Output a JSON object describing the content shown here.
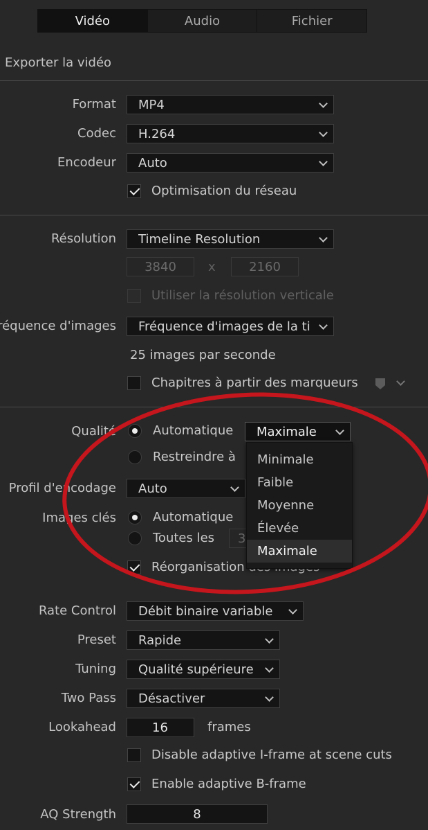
{
  "tabs": [
    {
      "label": "Vidéo",
      "active": true
    },
    {
      "label": "Audio",
      "active": false
    },
    {
      "label": "Fichier",
      "active": false
    }
  ],
  "export_video_label": "Exporter la vidéo",
  "format": {
    "label": "Format",
    "value": "MP4"
  },
  "codec": {
    "label": "Codec",
    "value": "H.264"
  },
  "encoder": {
    "label": "Encodeur",
    "value": "Auto"
  },
  "network_opt": {
    "label": "Optimisation du réseau",
    "checked": true
  },
  "resolution": {
    "label": "Résolution",
    "value": "Timeline Resolution",
    "width": "3840",
    "x": "x",
    "height": "2160"
  },
  "vertical_res": {
    "label": "Utiliser la résolution verticale",
    "checked": false,
    "disabled": true
  },
  "framerate": {
    "label": "réquence d'images",
    "value": "Fréquence d'images de la ti",
    "fps_text": "25 images par seconde"
  },
  "chapters": {
    "label": "Chapitres à partir des marqueurs",
    "checked": false
  },
  "quality": {
    "label": "Qualité",
    "auto_label": "Automatique",
    "restrict_label": "Restreindre à",
    "value": "Maximale",
    "options": [
      "Minimale",
      "Faible",
      "Moyenne",
      "Élevée",
      "Maximale"
    ],
    "selected": "Maximale"
  },
  "encoding_profile": {
    "label": "Profil d'encodage",
    "value": "Auto"
  },
  "keyframes": {
    "label": "Images clés",
    "auto_label": "Automatique",
    "every_label": "Toutes les",
    "every_value": "3"
  },
  "reorder": {
    "label": "Réorganisation des images",
    "checked": true
  },
  "rate_control": {
    "label": "Rate Control",
    "value": "Débit binaire variable"
  },
  "preset": {
    "label": "Preset",
    "value": "Rapide"
  },
  "tuning": {
    "label": "Tuning",
    "value": "Qualité supérieure"
  },
  "two_pass": {
    "label": "Two Pass",
    "value": "Désactiver"
  },
  "lookahead": {
    "label": "Lookahead",
    "value": "16",
    "unit": "frames"
  },
  "adaptive_i": {
    "label": "Disable adaptive I-frame at scene cuts",
    "checked": false
  },
  "adaptive_b": {
    "label": "Enable adaptive B-frame",
    "checked": true
  },
  "aq_strength": {
    "label": "AQ Strength",
    "value": "8"
  },
  "colors": {
    "annotation_ring": "#c4161c",
    "background": "#282828"
  }
}
